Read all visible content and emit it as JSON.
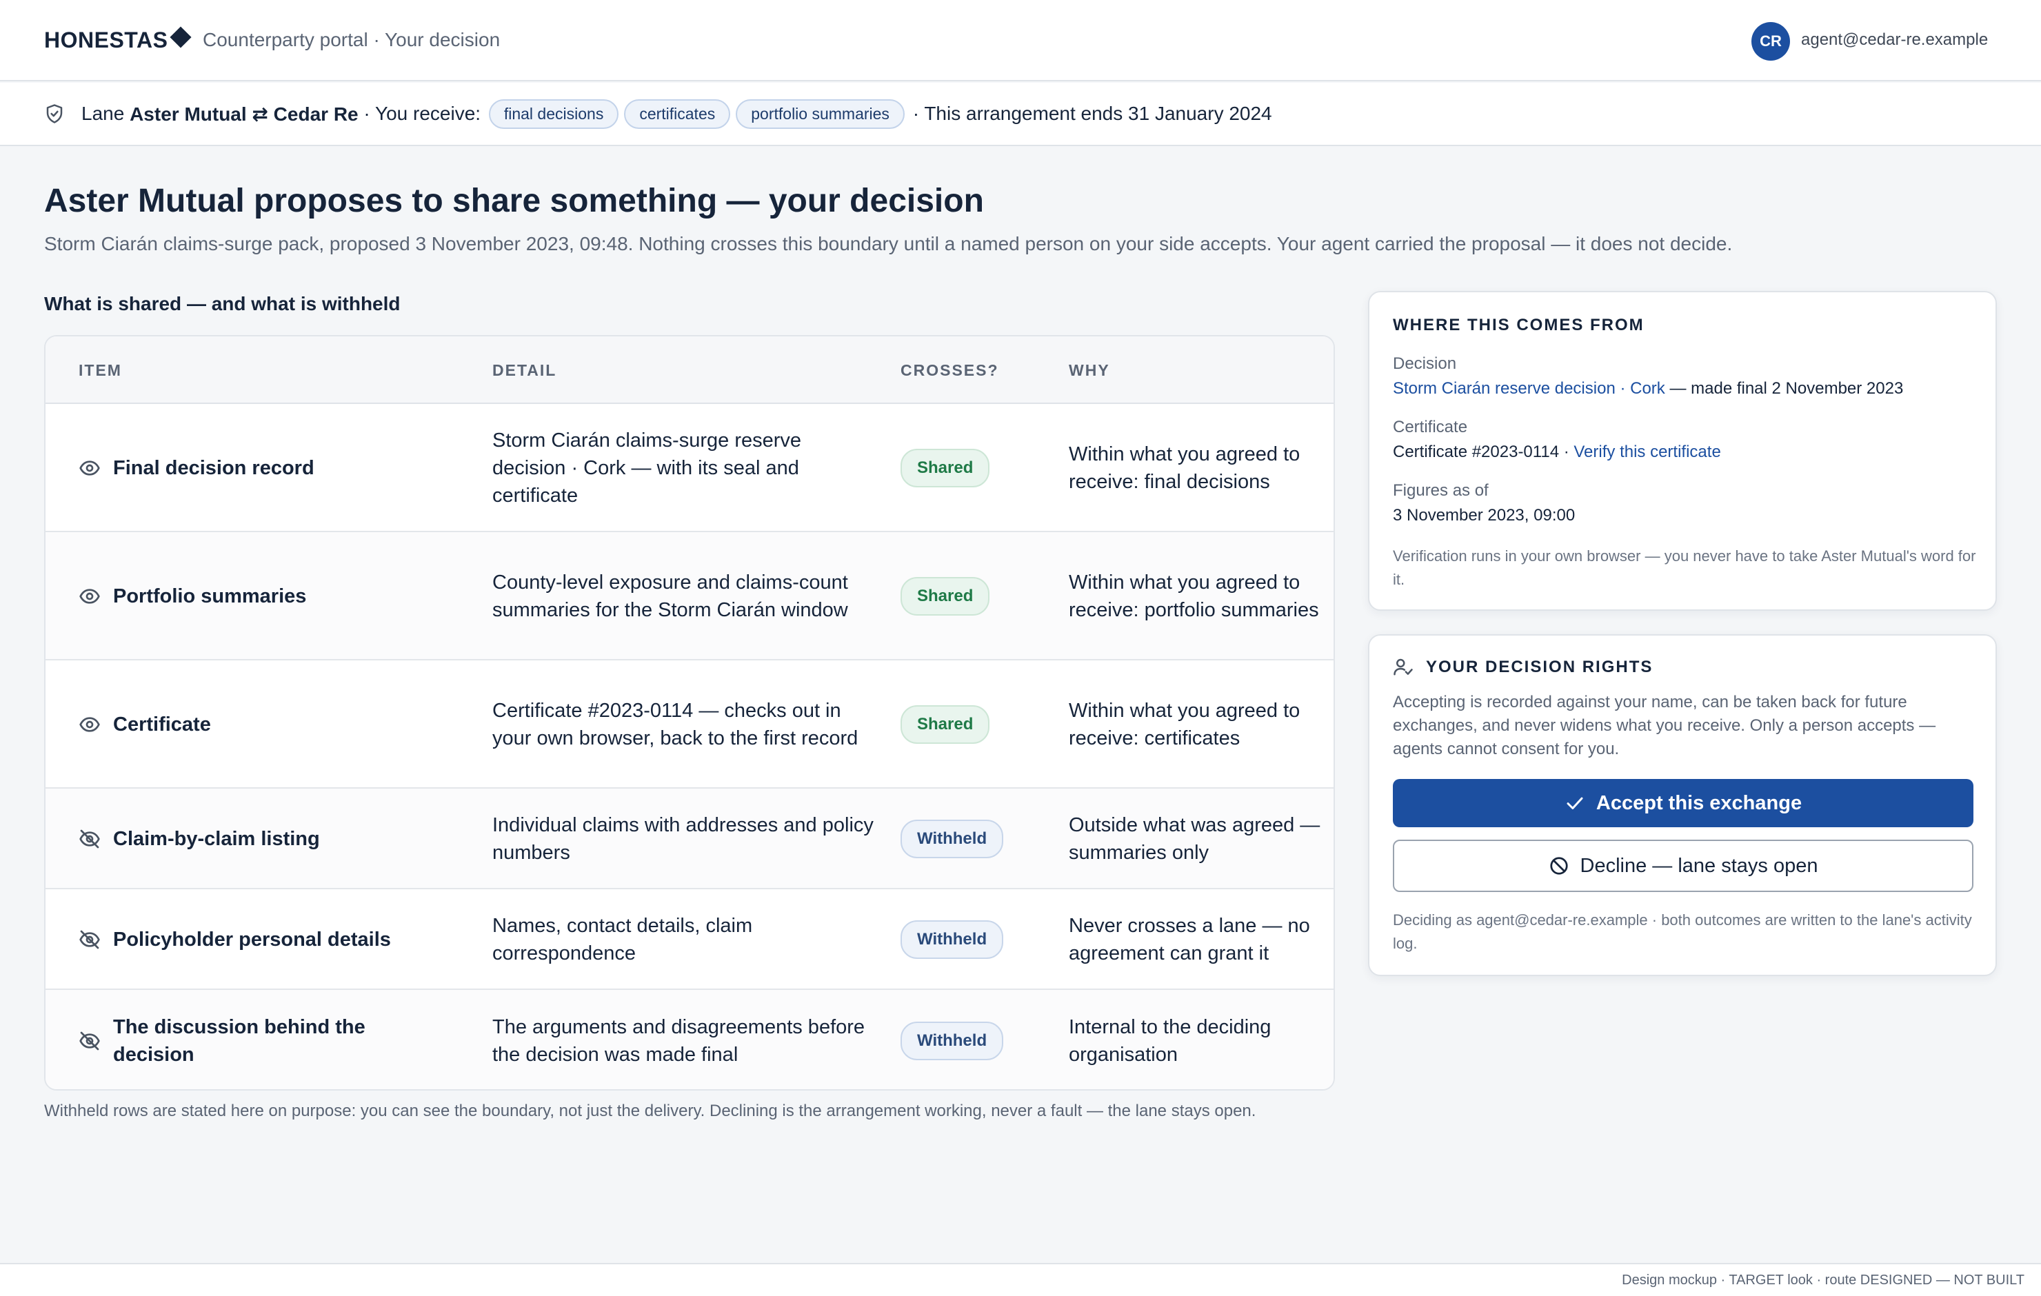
{
  "header": {
    "brand": "HONESTAS",
    "subtitle": "Counterparty portal · Your decision",
    "avatar_initials": "CR",
    "user_email": "agent@cedar-re.example"
  },
  "lane": {
    "prefix": "Lane",
    "parties": "Aster Mutual ⇄ Cedar Re",
    "receive_label": "· You receive:",
    "chips": [
      "final decisions",
      "certificates",
      "portfolio summaries"
    ],
    "ends": "· This arrangement ends 31 January 2024"
  },
  "page": {
    "title": "Aster Mutual proposes to share something — your decision",
    "subtitle": "Storm Ciarán claims-surge pack, proposed 3 November 2023, 09:48. Nothing crosses this boundary until a named person on your side accepts. Your agent carried the proposal — it does not decide."
  },
  "table": {
    "section_label": "What is shared — and what is withheld",
    "headers": {
      "item": "ITEM",
      "detail": "DETAIL",
      "crosses": "CROSSES?",
      "why": "WHY"
    },
    "rows": [
      {
        "item": "Final decision record",
        "icon": "eye-icon",
        "detail": "Storm Ciarán claims-surge reserve decision · Cork — with its seal and certificate",
        "status": "Shared",
        "why": "Within what you agreed to receive: final decisions"
      },
      {
        "item": "Portfolio summaries",
        "icon": "eye-icon",
        "detail": "County-level exposure and claims-count summaries for the Storm Ciarán window",
        "status": "Shared",
        "why": "Within what you agreed to receive: portfolio summaries"
      },
      {
        "item": "Certificate",
        "icon": "eye-icon",
        "detail": "Certificate #2023-0114 — checks out in your own browser, back to the first record",
        "status": "Shared",
        "why": "Within what you agreed to receive: certificates"
      },
      {
        "item": "Claim-by-claim listing",
        "icon": "eye-off-icon",
        "detail": "Individual claims with addresses and policy numbers",
        "status": "Withheld",
        "why": "Outside what was agreed — summaries only"
      },
      {
        "item": "Policyholder personal details",
        "icon": "eye-off-icon",
        "detail": "Names, contact details, claim correspondence",
        "status": "Withheld",
        "why": "Never crosses a lane — no agreement can grant it"
      },
      {
        "item": "The discussion behind the decision",
        "icon": "eye-off-icon",
        "detail": "The arguments and disagreements before the decision was made final",
        "status": "Withheld",
        "why": "Internal to the deciding organisation"
      }
    ],
    "footnote": "Withheld rows are stated here on purpose: you can see the boundary, not just the delivery. Declining is the arrangement working, never a fault — the lane stays open."
  },
  "provenance": {
    "heading": "WHERE THIS COMES FROM",
    "decision_label": "Decision",
    "decision_link": "Storm Ciarán reserve decision · Cork",
    "decision_suffix": " — made final 2 November 2023",
    "certificate_label": "Certificate",
    "certificate_value": "Certificate #2023-0114 · ",
    "certificate_link": "Verify this certificate",
    "figures_label": "Figures as of",
    "figures_value": "3 November 2023, 09:00",
    "note": "Verification runs in your own browser — you never have to take Aster Mutual's word for it."
  },
  "rights": {
    "heading": "YOUR DECISION RIGHTS",
    "text": "Accepting is recorded against your name, can be taken back for future exchanges, and never widens what you receive. Only a person accepts — agents cannot consent for you.",
    "accept_label": "Accept this exchange",
    "decline_label": "Decline — lane stays open",
    "note": "Deciding as agent@cedar-re.example · both outcomes are written to the lane's activity log."
  },
  "footer": {
    "mockup_note": "Design mockup · TARGET look · route DESIGNED — NOT BUILT"
  },
  "colors": {
    "accent": "#1c4fa0",
    "shared": "#1f7a47",
    "withheld": "#2a4a7a",
    "text": "#16243a"
  }
}
